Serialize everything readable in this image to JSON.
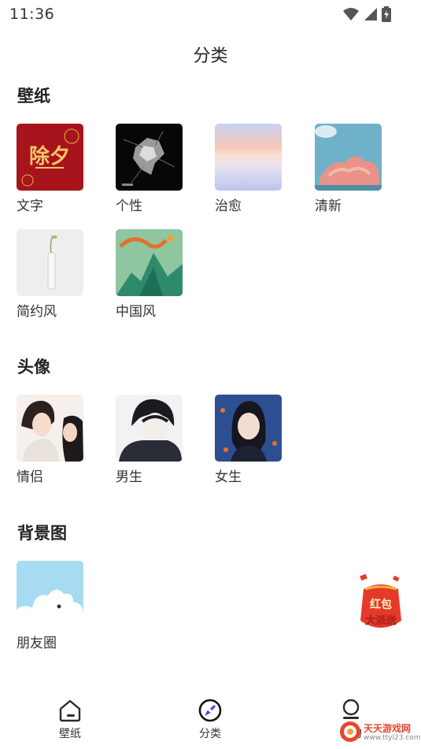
{
  "status_bar": {
    "time": "11:36"
  },
  "header": {
    "title": "分类"
  },
  "sections": [
    {
      "title": "壁纸",
      "items": [
        {
          "label": "文字",
          "thumb_text": "除夕"
        },
        {
          "label": "个性"
        },
        {
          "label": "治愈"
        },
        {
          "label": "清新"
        },
        {
          "label": "简约风"
        },
        {
          "label": "中国风"
        }
      ]
    },
    {
      "title": "头像",
      "items": [
        {
          "label": "情侣"
        },
        {
          "label": "男生"
        },
        {
          "label": "女生"
        }
      ]
    },
    {
      "title": "背景图",
      "items": [
        {
          "label": "朋友圈"
        }
      ]
    }
  ],
  "float_badge": {
    "line1": "红包",
    "line2": "大派送"
  },
  "bottom_nav": {
    "items": [
      {
        "label": "壁纸",
        "icon": "home-icon"
      },
      {
        "label": "分类",
        "icon": "compass-icon",
        "active": true
      },
      {
        "label": "我的",
        "icon": "profile-icon"
      }
    ]
  },
  "watermark": {
    "text": "天天游戏网",
    "url": "www.ttyl23.com"
  },
  "colors": {
    "accent": "#5b3cf0",
    "badge_red": "#e53a2a"
  }
}
